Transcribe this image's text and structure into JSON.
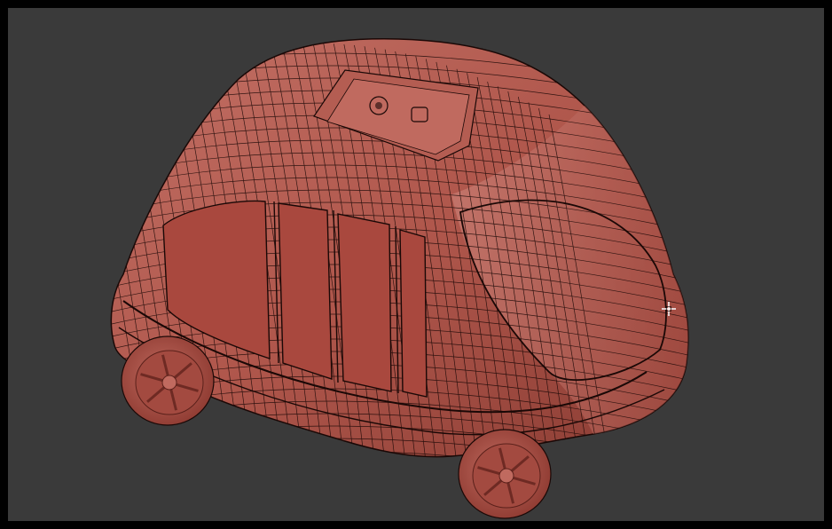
{
  "viewport": {
    "background": "#3a3a3a",
    "frame": "#000000"
  },
  "model": {
    "object": "shuttle-bus-mesh",
    "display": "wireframe-on-shaded",
    "shade_color": "#b0574c",
    "shade_dark": "#7a342c",
    "shade_light": "#c97a6e",
    "wire_color": "#1a0806"
  },
  "cursor": {
    "icon": "crosshair-cursor-icon",
    "color": "#ffffff"
  }
}
